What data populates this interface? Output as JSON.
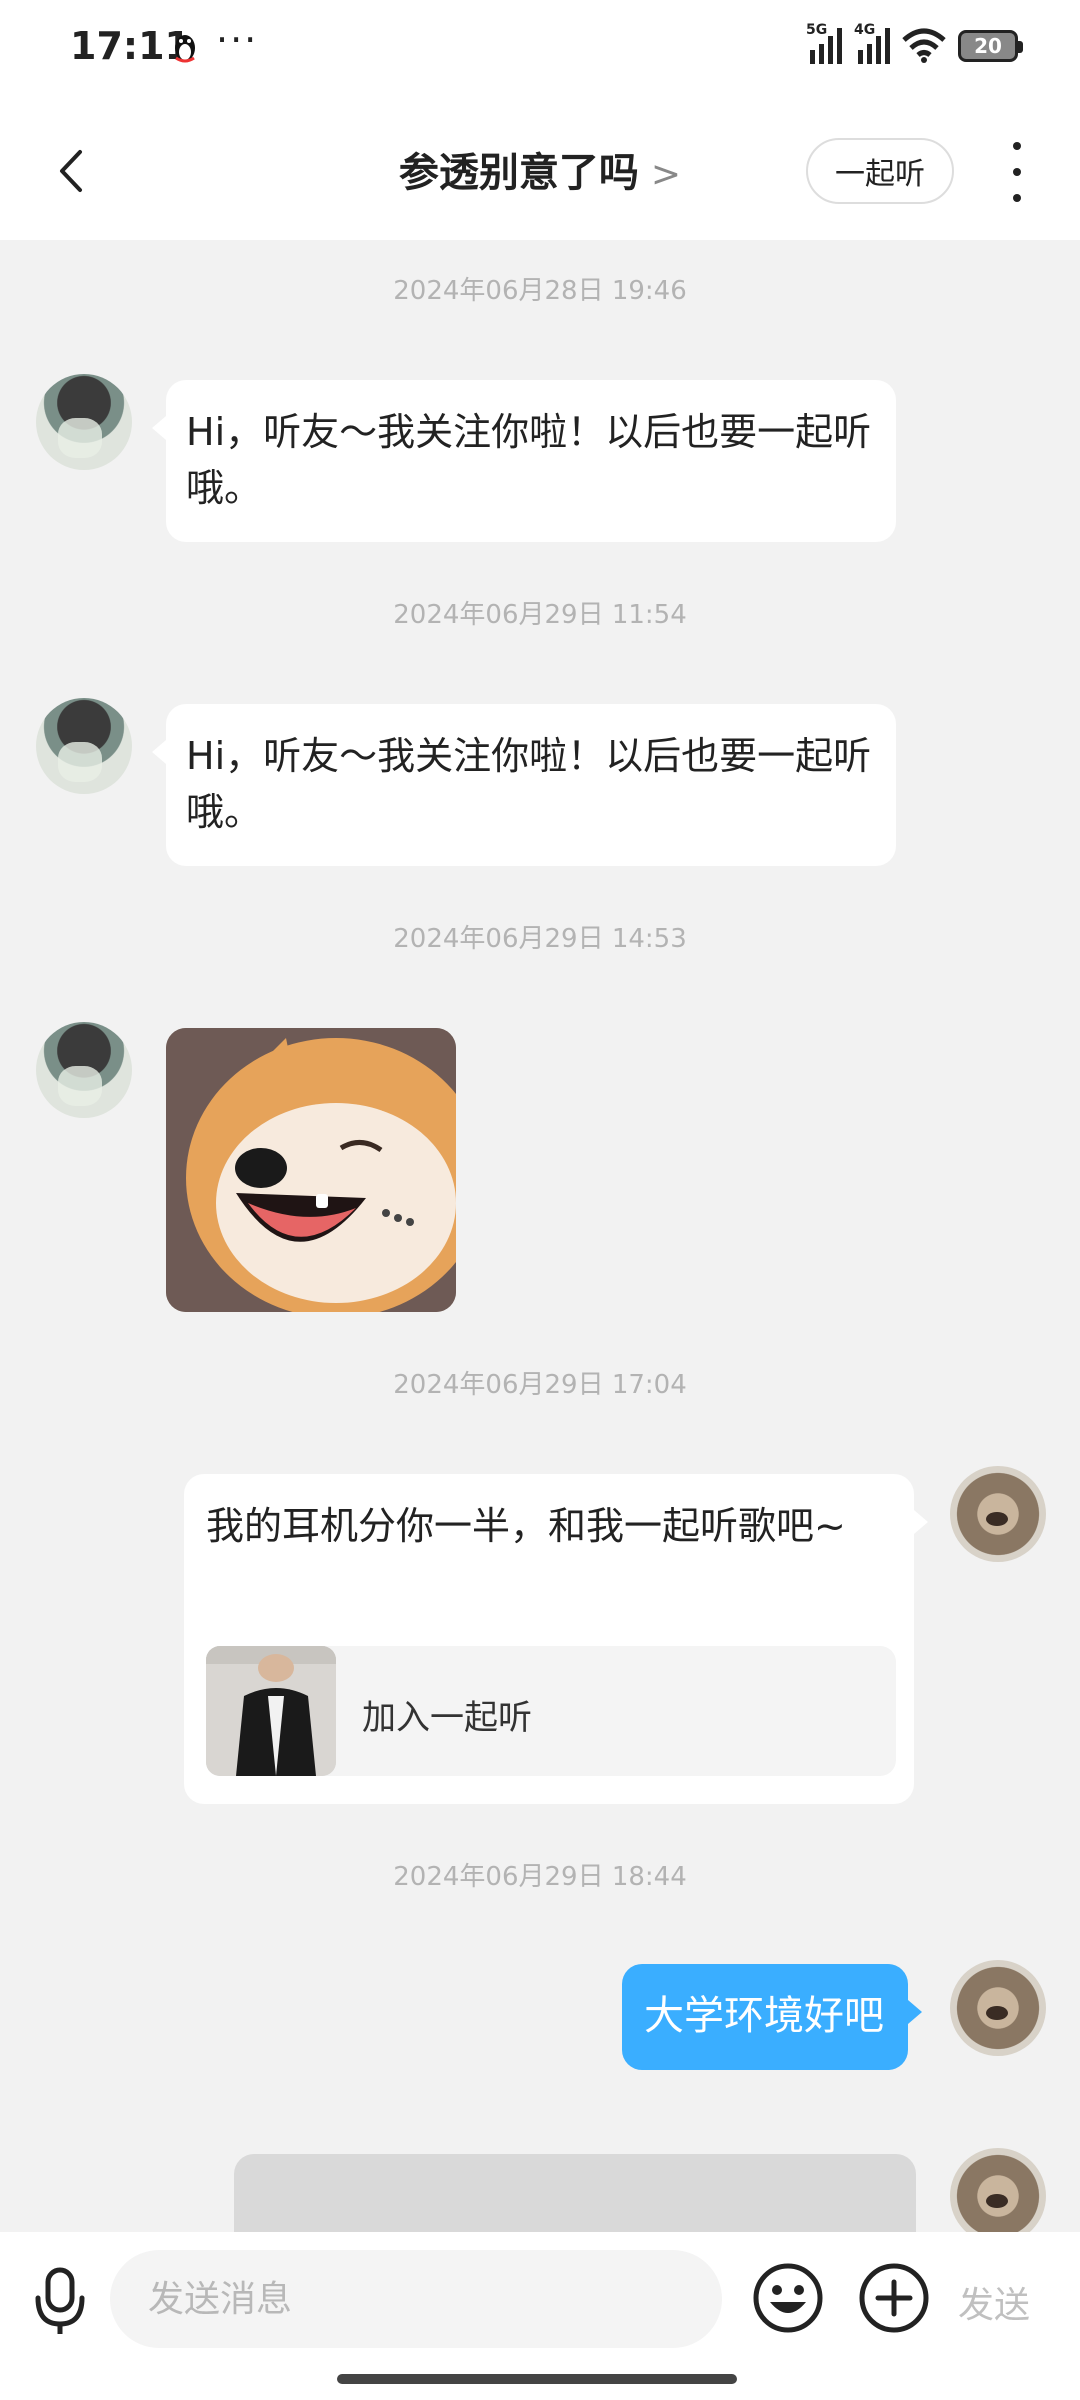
{
  "status_bar": {
    "time": "17:11",
    "more": "···",
    "net1": "5G",
    "net2": "4G",
    "battery": "20"
  },
  "header": {
    "title": "参透别意了吗",
    "title_chevron": ">",
    "listen_button": "一起听"
  },
  "messages": [
    {
      "timestamp": "2024年06月28日 19:46",
      "from": "them",
      "text": "Hi，听友～我关注你啦！以后也要一起听哦。"
    },
    {
      "timestamp": "2024年06月29日 11:54",
      "from": "them",
      "text": "Hi，听友～我关注你啦！以后也要一起听哦。"
    },
    {
      "timestamp": "2024年06月29日 14:53",
      "from": "them",
      "type": "sticker",
      "sticker_icon": "shiba-dog-sticker"
    },
    {
      "timestamp": "2024年06月29日 17:04",
      "from": "me",
      "text": "我的耳机分你一半，和我一起听歌吧~",
      "card_label": "加入一起听"
    },
    {
      "timestamp": "2024年06月29日 18:44",
      "from": "me",
      "text": "大学环境好吧"
    }
  ],
  "input": {
    "placeholder": "发送消息",
    "send_label": "发送"
  },
  "colors": {
    "accent": "#3aaeff",
    "background": "#f2f2f2",
    "timestamp": "#b3b3b3"
  }
}
